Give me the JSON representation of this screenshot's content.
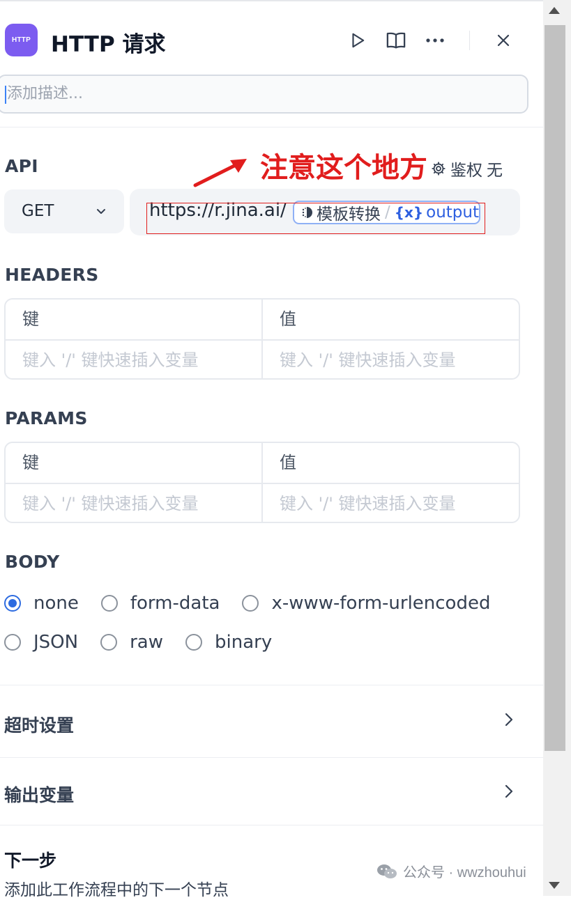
{
  "header": {
    "icon_label": "HTTP",
    "title": "HTTP 请求"
  },
  "description": {
    "placeholder": "添加描述..."
  },
  "api": {
    "section_label": "API",
    "annotation": "注意这个地方",
    "auth_label": "鉴权",
    "auth_value": "无",
    "method": "GET",
    "url_prefix": "https://r.jina.ai/",
    "variable": {
      "node": "模板转换",
      "separator": "/",
      "icon_text": "{x}",
      "name": "output"
    }
  },
  "headers": {
    "section_label": "HEADERS",
    "key_header": "键",
    "value_header": "值",
    "key_placeholder": "键入 '/' 键快速插入变量",
    "value_placeholder": "键入 '/' 键快速插入变量"
  },
  "params": {
    "section_label": "PARAMS",
    "key_header": "键",
    "value_header": "值",
    "key_placeholder": "键入 '/' 键快速插入变量",
    "value_placeholder": "键入 '/' 键快速插入变量"
  },
  "body": {
    "section_label": "BODY",
    "options": [
      "none",
      "form-data",
      "x-www-form-urlencoded",
      "JSON",
      "raw",
      "binary"
    ],
    "selected": "none"
  },
  "timeout": {
    "label": "超时设置"
  },
  "output_vars": {
    "label": "输出变量"
  },
  "next_step": {
    "title": "下一步",
    "description": "添加此工作流程中的下一个节点"
  },
  "watermark": {
    "text": "公众号 · wwzhouhui"
  }
}
